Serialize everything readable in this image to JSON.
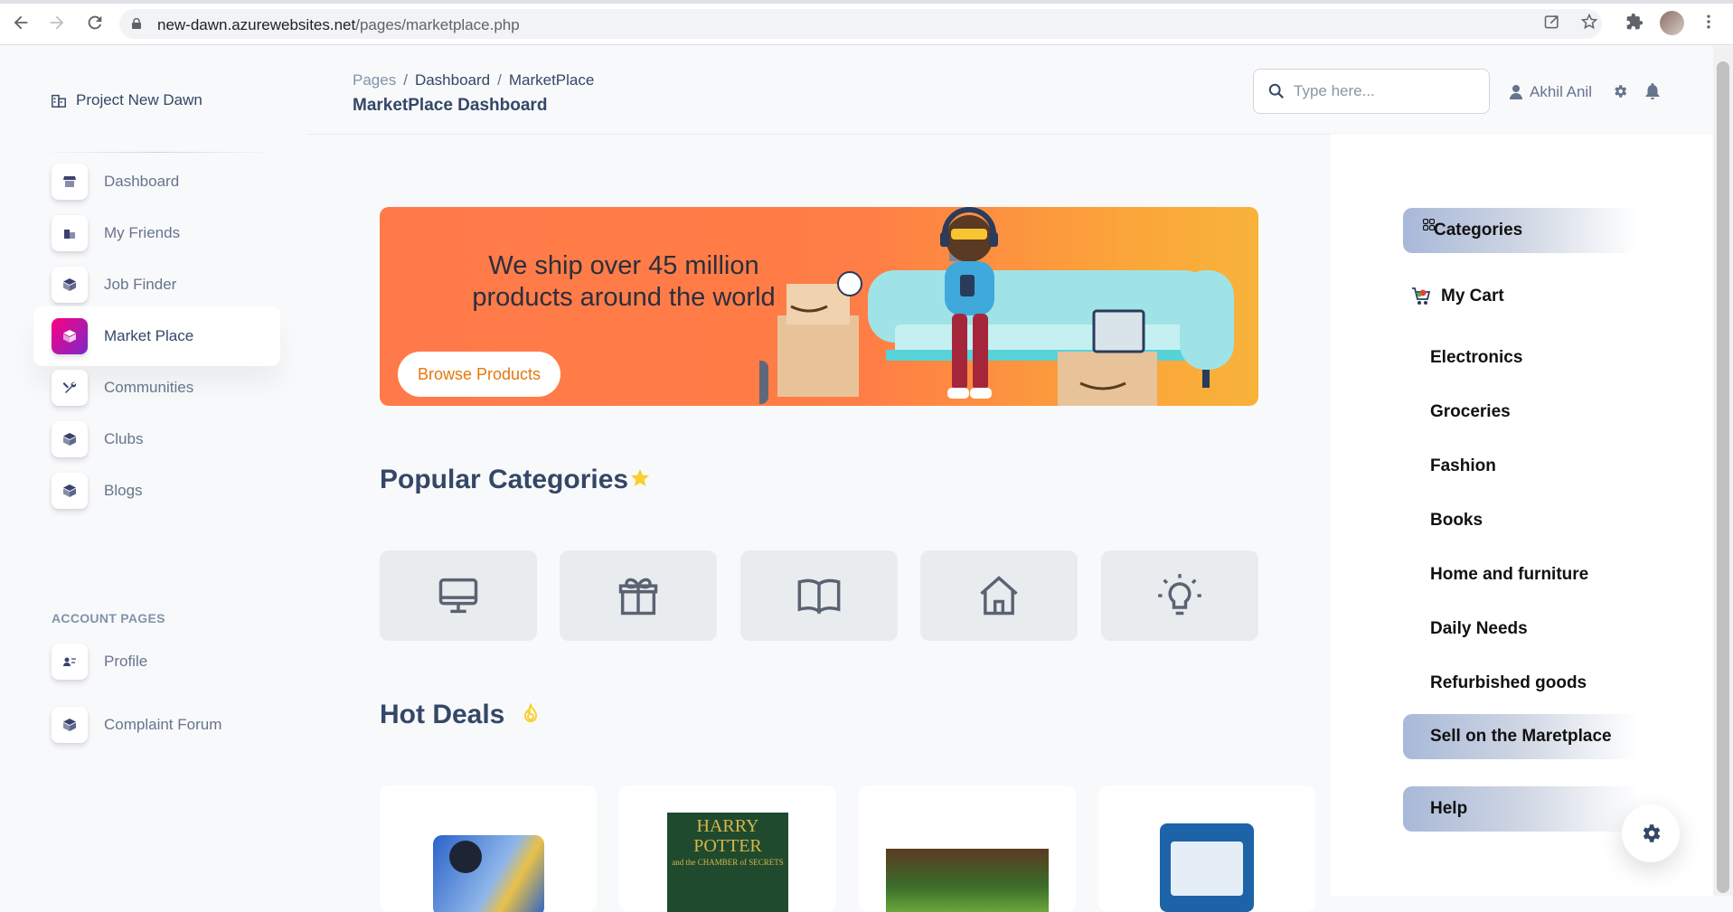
{
  "browser": {
    "url_domain": "new-dawn.azurewebsites.net",
    "url_path": "/pages/marketplace.php"
  },
  "sidebar": {
    "brand": "Project New Dawn",
    "items": [
      {
        "label": "Dashboard",
        "icon": "shop-icon"
      },
      {
        "label": "My Friends",
        "icon": "building-icon"
      },
      {
        "label": "Job Finder",
        "icon": "box-icon"
      },
      {
        "label": "Market Place",
        "icon": "box-icon",
        "active": true
      },
      {
        "label": "Communities",
        "icon": "tools-icon"
      },
      {
        "label": "Clubs",
        "icon": "box-icon"
      },
      {
        "label": "Blogs",
        "icon": "box-icon"
      }
    ],
    "section_label": "ACCOUNT PAGES",
    "account_items": [
      {
        "label": "Profile",
        "icon": "id-card-icon"
      },
      {
        "label": "Complaint Forum",
        "icon": "box-icon"
      }
    ]
  },
  "header": {
    "breadcrumb": [
      "Pages",
      "Dashboard",
      "MarketPlace"
    ],
    "title": "MarketPlace Dashboard",
    "search_placeholder": "Type here...",
    "user_name": "Akhil Anil"
  },
  "banner": {
    "line1": "We ship over 45 million",
    "line2": "products around the world",
    "button_label": "Browse Products"
  },
  "popular": {
    "title": "Popular Categories",
    "tiles": [
      "desktop-icon",
      "gift-icon",
      "book-icon",
      "home-icon",
      "lightbulb-icon"
    ]
  },
  "hot_deals": {
    "title": "Hot Deals",
    "book_cover_title": "HARRY POTTER",
    "book_cover_subtitle": "and the CHAMBER of SECRETS"
  },
  "right_panel": {
    "categories_label": "Categories",
    "cart_label": "My Cart",
    "items": [
      "Electronics",
      "Groceries",
      "Fashion",
      "Books",
      "Home and furniture",
      "Daily Needs",
      "Refurbished goods"
    ],
    "sell_label": "Sell on the Maretplace",
    "help_label": "Help"
  },
  "colors": {
    "accent_gradient_start": "#7928ca",
    "accent_gradient_end": "#ff0080",
    "banner_orange": "#ff7a4a",
    "star_yellow": "#fbcf33",
    "text_dark": "#344767"
  }
}
